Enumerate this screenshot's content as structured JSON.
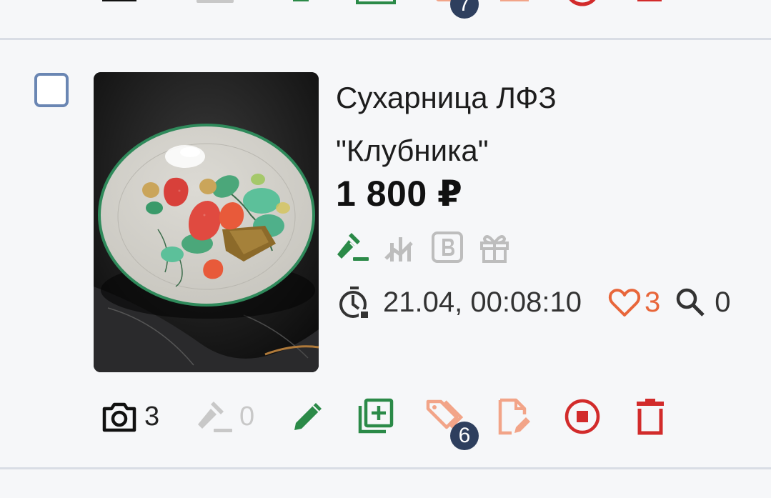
{
  "item": {
    "title_line1": "Сухарница ЛФЗ",
    "title_line2": "\"Клубника\"",
    "price": "1 800 ₽",
    "end_time": "21.04, 00:08:10",
    "likes": "3",
    "views": "0",
    "photos_count": "3",
    "bids_count": "0",
    "tags_badge": "6"
  },
  "previous_item": {
    "tags_badge": "7"
  },
  "badges": [
    "auction-active-icon",
    "price-chart-icon",
    "b-square-icon",
    "gift-icon"
  ],
  "colors": {
    "green": "#2b8a48",
    "orange": "#e8663a",
    "red": "#d22b2b",
    "gray": "#bdbdbd",
    "navy_badge": "#2e3f5e",
    "checkbox_border": "#6a86b3"
  }
}
